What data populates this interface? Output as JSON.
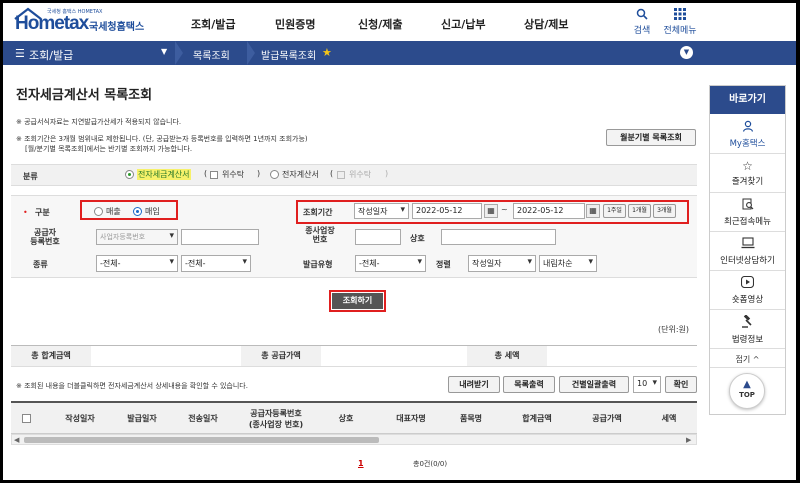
{
  "header": {
    "logo_tiny": "국세청 홈택스 HOMETAX",
    "logo_main": "Hometax",
    "logo_sub": "국세청홈택스",
    "nav": [
      "조회/발급",
      "민원증명",
      "신청/제출",
      "신고/납부",
      "상담/제보"
    ],
    "search_label": "검색",
    "menu_label": "전체메뉴"
  },
  "breadcrumb": {
    "section": "조회/발급",
    "level2": "목록조회",
    "level3": "발급목록조회"
  },
  "page": {
    "title": "전자세금계산서 목록조회",
    "note1": "※ 공급서식자료는 지연발급가산세가 적용되지 않습니다.",
    "note2": "※ 조회기간은 3개월 범위내로 제한됩니다. (단, 공급받는자 등록번호를 입력하면 1년까지 조회가능)",
    "note3": "[월/분기별 목록조회]에서는 반기별 조회까지 가능합니다.",
    "quarterly_button": "월분기별 목록조회"
  },
  "form": {
    "category_label": "분류",
    "cat_option1": "전자세금계산서",
    "cat_option1_sub": "위수탁",
    "cat_option2": "전자계산서",
    "cat_option2_sub": "위수탁",
    "type_label": "구분",
    "type_sales": "매출",
    "type_purchase": "매입",
    "period_label": "조회기간",
    "period_basis": "작성일자",
    "date_from": "2022-05-12",
    "date_tilde": "~",
    "date_to": "2022-05-12",
    "quick1": "1주일",
    "quick2": "1개월",
    "quick3": "3개월",
    "supplier_label1": "공급자",
    "supplier_label2": "등록번호",
    "supplier_type": "사업자등록번호",
    "branch_label1": "종사업장",
    "branch_label2": "번호",
    "company_label": "상호",
    "kind_label": "종류",
    "kind_sel1": "-전체-",
    "kind_sel2": "-전체-",
    "issue_type_label": "발급유형",
    "issue_type_sel": "-전체-",
    "sort_label": "정렬",
    "sort_sel1": "작성일자",
    "sort_sel2": "내림차순",
    "search_button": "조회하기"
  },
  "summary": {
    "unit": "(단위:원)",
    "total_amount": "총 합계금액",
    "total_supply": "총 공급가액",
    "total_tax": "총 세액"
  },
  "list": {
    "note": "※ 조회된 내용을 더블클릭하면 전자세금계산서 상세내용을 확인할 수 있습니다.",
    "download": "내려받기",
    "print_list": "목록출력",
    "print_batch": "건별일괄출력",
    "page_size": "10",
    "confirm": "확인",
    "columns": [
      "작성일자",
      "발급일자",
      "전송일자",
      "공급자등록번호\n(종사업장 번호)",
      "상호",
      "대표자명",
      "품목명",
      "합계금액",
      "공급가액",
      "세액"
    ],
    "page_current": "1",
    "total_count": "총0건(0/0)"
  },
  "sidebar": {
    "title": "바로가기",
    "items": [
      {
        "icon": "person-icon",
        "label": "My홈택스"
      },
      {
        "icon": "star-icon",
        "label": "즐겨찾기"
      },
      {
        "icon": "search-doc-icon",
        "label": "최근접속메뉴"
      },
      {
        "icon": "laptop-icon",
        "label": "인터넷상담하기"
      },
      {
        "icon": "play-icon",
        "label": "숏폼영상"
      },
      {
        "icon": "gavel-icon",
        "label": "법령정보"
      }
    ],
    "collapse": "접기",
    "top": "TOP"
  }
}
